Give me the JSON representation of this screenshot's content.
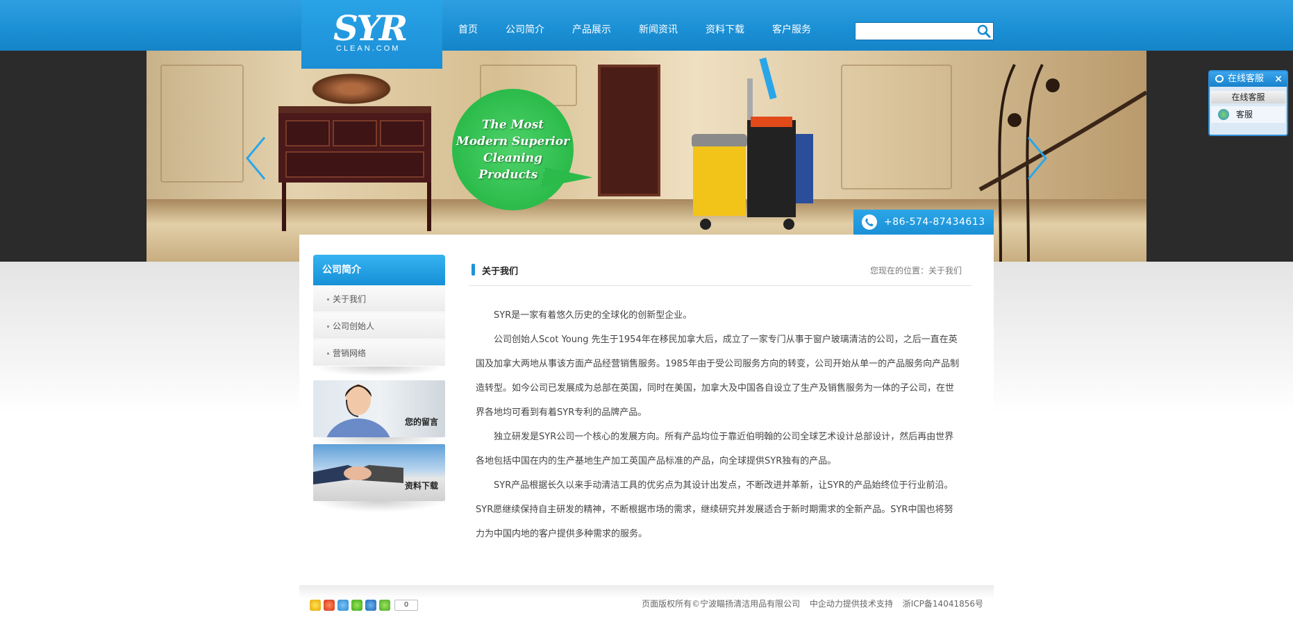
{
  "header": {
    "logo_main": "SYR",
    "logo_sub": "CLEAN.COM",
    "nav": [
      "首页",
      "公司简介",
      "产品展示",
      "新闻资讯",
      "资料下载",
      "客户服务"
    ],
    "search_placeholder": ""
  },
  "banner": {
    "bubble_lines": [
      "The Most",
      "Modern Superior",
      "Cleaning",
      "Products !"
    ],
    "phone": "+86-574-87434613"
  },
  "sidebar": {
    "title": "公司简介",
    "items": [
      "关于我们",
      "公司创始人",
      "营销网络"
    ],
    "promo_message": "您的留言",
    "promo_download": "资料下载"
  },
  "main": {
    "title": "关于我们",
    "breadcrumb": "您现在的位置：关于我们",
    "paragraphs": [
      "SYR是一家有着悠久历史的全球化的创新型企业。",
      "公司创始人Scot Young 先生于1954年在移民加拿大后，成立了一家专门从事于窗户玻璃清洁的公司，之后一直在英国及加拿大两地从事该方面产品经营销售服务。1985年由于受公司服务方向的转变，公司开始从单一的产品服务向产品制造转型。如今公司已发展成为总部在英国，同时在美国，加拿大及中国各自设立了生产及销售服务为一体的子公司，在世界各地均可看到有着SYR专利的品牌产品。",
      "独立研发是SYR公司一个核心的发展方向。所有产品均位于靠近伯明翰的公司全球艺术设计总部设计，然后再由世界各地包括中国在内的生产基地生产加工英国产品标准的产品，向全球提供SYR独有的产品。",
      "SYR产品根据长久以来手动清洁工具的优劣点为其设计出发点，不断改进并革新，让SYR的产品始终位于行业前沿。SYR愿继续保持自主研发的精神，不断根据市场的需求，继续研究并发展适合于新时期需求的全新产品。SYR中国也将努力为中国内地的客户提供多种需求的服务。"
    ]
  },
  "footer": {
    "copyright": "页面版权所有©宁波瞄扬清洁用品有限公司",
    "support": "中企动力提供技术支持",
    "icp": "浙ICP备14041856号",
    "share_count": "0",
    "share_icons": [
      "qzone-icon",
      "weibo-icon",
      "tencent-weibo-icon",
      "wechat-icon",
      "renren-icon",
      "more-share-icon"
    ]
  },
  "online_service": {
    "title": "在线客服",
    "subtitle": "在线客服",
    "agent": "客服"
  },
  "colors": {
    "brand_blue": "#1b8fd4",
    "bubble_green": "#2bbb4a"
  }
}
